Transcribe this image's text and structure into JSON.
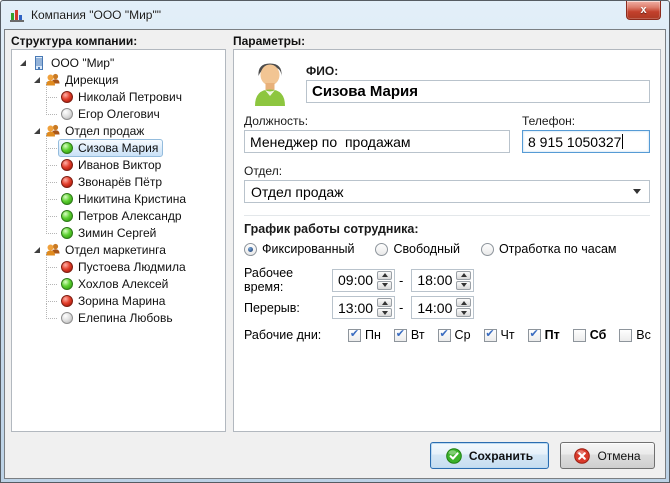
{
  "window": {
    "title": "Компания \"ООО \"Мир\"\"",
    "close_glyph": "x"
  },
  "sidebar": {
    "header": "Структура компании:",
    "tree": [
      {
        "label": "ООО \"Мир\"",
        "kind": "company",
        "expanded": true
      },
      {
        "label": "Дирекция",
        "kind": "department",
        "expanded": true
      },
      {
        "label": "Николай Петрович",
        "kind": "employee",
        "status": "red"
      },
      {
        "label": "Егор Олегович",
        "kind": "employee",
        "status": "gray"
      },
      {
        "label": "Отдел продаж",
        "kind": "department",
        "expanded": true
      },
      {
        "label": "Сизова Мария",
        "kind": "employee",
        "status": "green",
        "selected": true
      },
      {
        "label": "Иванов Виктор",
        "kind": "employee",
        "status": "red"
      },
      {
        "label": "Звонарёв Пётр",
        "kind": "employee",
        "status": "red"
      },
      {
        "label": "Никитина Кристина",
        "kind": "employee",
        "status": "green"
      },
      {
        "label": "Петров Александр",
        "kind": "employee",
        "status": "green"
      },
      {
        "label": "Зимин Сергей",
        "kind": "employee",
        "status": "green"
      },
      {
        "label": "Отдел маркетинга",
        "kind": "department",
        "expanded": true
      },
      {
        "label": "Пустоева Людмила",
        "kind": "employee",
        "status": "red"
      },
      {
        "label": "Хохлов Алексей",
        "kind": "employee",
        "status": "green"
      },
      {
        "label": "Зорина Марина",
        "kind": "employee",
        "status": "red"
      },
      {
        "label": "Елепина Любовь",
        "kind": "employee",
        "status": "gray"
      }
    ]
  },
  "params": {
    "header": "Параметры:",
    "fio": {
      "label": "ФИО:",
      "value": "Сизова Мария"
    },
    "position": {
      "label": "Должность:",
      "value": "Менеджер по  продажам"
    },
    "phone": {
      "label": "Телефон:",
      "value": "8 915 1050327"
    },
    "department": {
      "label": "Отдел:",
      "value": "Отдел продаж"
    },
    "schedule": {
      "header": "График работы сотрудника:",
      "modes": [
        {
          "label": "Фиксированный",
          "selected": true
        },
        {
          "label": "Свободный",
          "selected": false
        },
        {
          "label": "Отработка по часам",
          "selected": false
        }
      ],
      "range_separator": "-",
      "work_time": {
        "label": "Рабочее время:",
        "from": "09:00",
        "to": "18:00"
      },
      "break_time": {
        "label": "Перерыв:",
        "from": "13:00",
        "to": "14:00"
      },
      "work_days": {
        "label": "Рабочие дни:",
        "days": [
          {
            "label": "Пн",
            "checked": true
          },
          {
            "label": "Вт",
            "checked": true
          },
          {
            "label": "Ср",
            "checked": true
          },
          {
            "label": "Чт",
            "checked": true
          },
          {
            "label": "Пт",
            "checked": true
          },
          {
            "label": "Сб",
            "checked": false
          },
          {
            "label": "Вс",
            "checked": false
          }
        ]
      }
    }
  },
  "footer": {
    "save_label": "Сохранить",
    "cancel_label": "Отмена"
  },
  "colors": {
    "titlebar": "#cfe0f0",
    "focus_border": "#569bd5",
    "selection_border": "#94bcdd",
    "status_red": "#e3402d",
    "status_green": "#5ed032",
    "status_gray": "#e0e0e0",
    "save_icon_green": "#3bb22a",
    "cancel_icon_red": "#d93a2b"
  }
}
